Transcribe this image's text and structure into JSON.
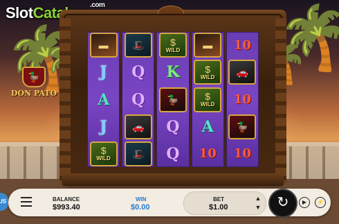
{
  "watermark": {
    "prefix": "Slot",
    "suffix": "Catalog",
    "dot_com": ".com"
  },
  "game": {
    "logo_text": "DON PATO",
    "logo_icon": "duck-mobster-icon"
  },
  "reels": [
    [
      {
        "symbol": "cigar",
        "label": ""
      },
      {
        "symbol": "J",
        "label": "J"
      },
      {
        "symbol": "A",
        "label": "A"
      },
      {
        "symbol": "J",
        "label": "J"
      },
      {
        "symbol": "wild",
        "label": "WILD"
      }
    ],
    [
      {
        "symbol": "hat",
        "label": ""
      },
      {
        "symbol": "Q",
        "label": "Q"
      },
      {
        "symbol": "Q",
        "label": "Q"
      },
      {
        "symbol": "car",
        "label": ""
      },
      {
        "symbol": "hat",
        "label": ""
      }
    ],
    [
      {
        "symbol": "wild",
        "label": "WILD"
      },
      {
        "symbol": "K",
        "label": "K"
      },
      {
        "symbol": "duck",
        "label": ""
      },
      {
        "symbol": "Q",
        "label": "Q"
      },
      {
        "symbol": "Q",
        "label": "Q"
      }
    ],
    [
      {
        "symbol": "cigar",
        "label": ""
      },
      {
        "symbol": "wild",
        "label": "WILD"
      },
      {
        "symbol": "wild",
        "label": "WILD"
      },
      {
        "symbol": "A",
        "label": "A"
      },
      {
        "symbol": "10",
        "label": "10"
      }
    ],
    [
      {
        "symbol": "10",
        "label": "10"
      },
      {
        "symbol": "car",
        "label": ""
      },
      {
        "symbol": "10",
        "label": "10"
      },
      {
        "symbol": "duck",
        "label": ""
      },
      {
        "symbol": "10",
        "label": "10"
      }
    ]
  ],
  "bar": {
    "balance_label": "BALANCE",
    "balance_value": "$993.40",
    "win_label": "WIN",
    "win_value": "$0.00",
    "bet_label": "BET",
    "bet_value": "$1.00",
    "sound_label": "US"
  },
  "colors": {
    "reel_bg": "#7a45c4",
    "frame": "#4a2a10",
    "win_text": "#2a7ad0",
    "bar_bg": "#f2ece2"
  }
}
